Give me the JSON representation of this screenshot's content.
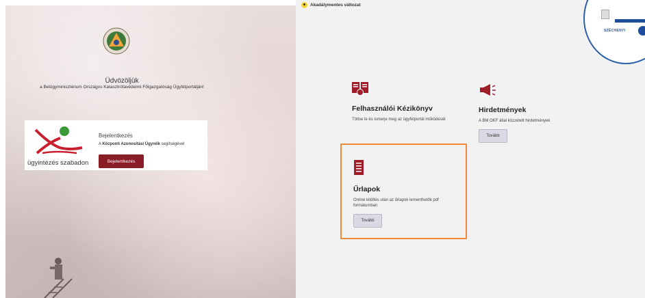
{
  "welcome": {
    "title": "Üdvözöljük",
    "subtitle": "a Belügyminisztérium Országos Katasztrófavédelmi Főigazgatóság Ügyfélportálján!"
  },
  "login": {
    "logo_text": "ügyintézés szabadon",
    "title": "Bejelentkezés",
    "subtitle_prefix": "A ",
    "subtitle_bold": "Központi Azonosítási Ügynök",
    "subtitle_suffix": " segítségével",
    "button_label": "Bejelentkezés"
  },
  "accessibility": {
    "label": "Akadálymentes változat"
  },
  "szechenyi": {
    "label": "SZÉCHENYI"
  },
  "cards": {
    "manual": {
      "title": "Felhasználói Kézikönyv",
      "description": "Töltse le és ismerje meg az ügyfélportál működését"
    },
    "notices": {
      "title": "Hirdetmények",
      "description": "A BM OKF által közzétett hirdetmények",
      "button_label": "Tovább"
    },
    "forms": {
      "title": "Űrlapok",
      "description": "Online kitöltés után az űrlapok lementhetők pdf formátumban",
      "button_label": "Tovább"
    }
  },
  "colors": {
    "brand_red": "#8a1c25",
    "highlight_orange": "#f08a3a",
    "button_bg": "#ddd8e6"
  }
}
